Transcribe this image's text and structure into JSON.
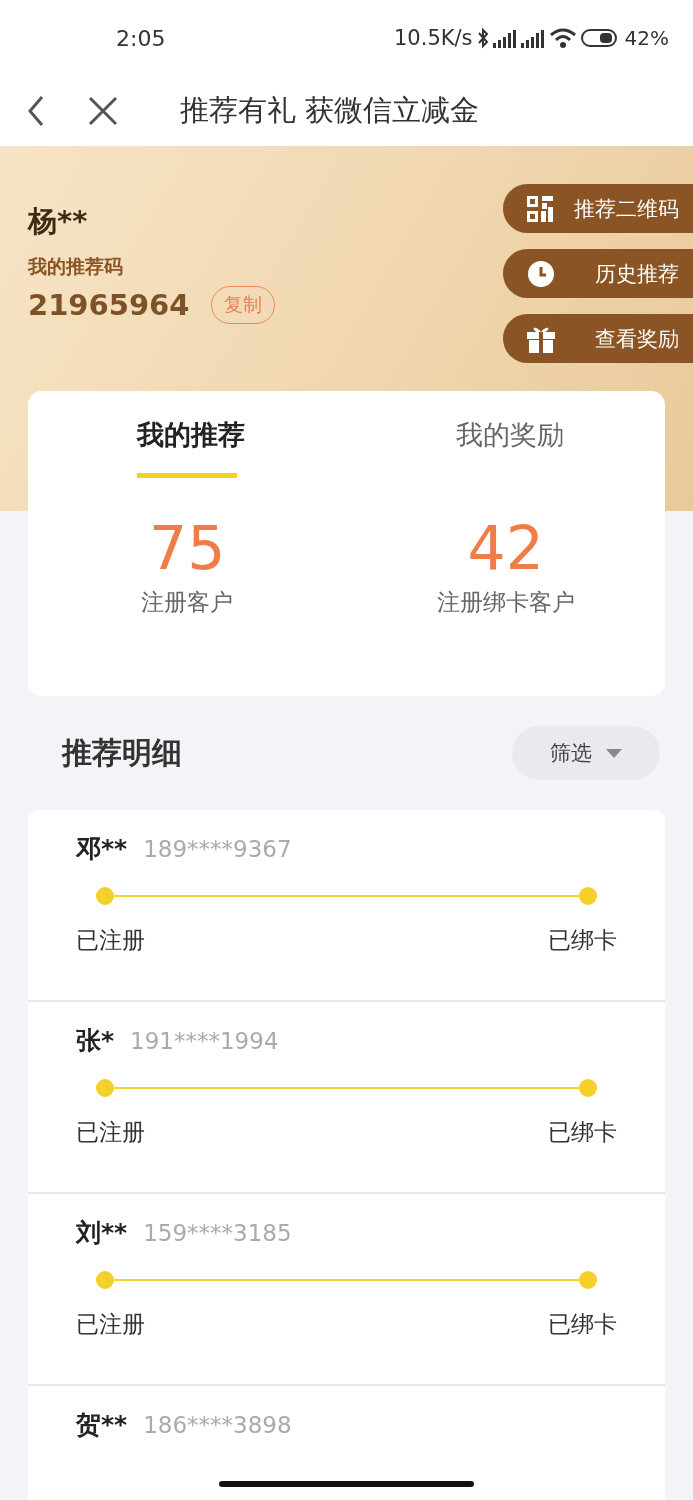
{
  "status_bar": {
    "time": "2:05",
    "speed": "10.5K/s",
    "battery": "42%"
  },
  "header": {
    "title": "推荐有礼 获微信立减金"
  },
  "profile": {
    "name": "杨**",
    "code_label": "我的推荐码",
    "code": "21965964",
    "copy": "复制"
  },
  "side_buttons": [
    {
      "kind": "qr",
      "label": "推荐二维码"
    },
    {
      "kind": "clock",
      "label": "历史推荐"
    },
    {
      "kind": "gift",
      "label": "查看奖励"
    }
  ],
  "tabs": [
    {
      "label": "我的推荐",
      "selected": true
    },
    {
      "label": "我的奖励",
      "selected": false
    }
  ],
  "stats": [
    {
      "value": "75",
      "label": "注册客户"
    },
    {
      "value": "42",
      "label": "注册绑卡客户"
    }
  ],
  "details": {
    "title": "推荐明细",
    "filter": "筛选"
  },
  "records": [
    {
      "name": "邓**",
      "phone": "189****9367",
      "steps": [
        {
          "label": "已注册",
          "done": true
        },
        {
          "label": "已绑卡",
          "done": true
        }
      ]
    },
    {
      "name": "张*",
      "phone": "191****1994",
      "steps": [
        {
          "label": "已注册",
          "done": true
        },
        {
          "label": "已绑卡",
          "done": true
        }
      ]
    },
    {
      "name": "刘**",
      "phone": "159****3185",
      "steps": [
        {
          "label": "已注册",
          "done": true
        },
        {
          "label": "已绑卡",
          "done": true
        }
      ]
    },
    {
      "name": "贺**",
      "phone": "186****3898"
    }
  ]
}
